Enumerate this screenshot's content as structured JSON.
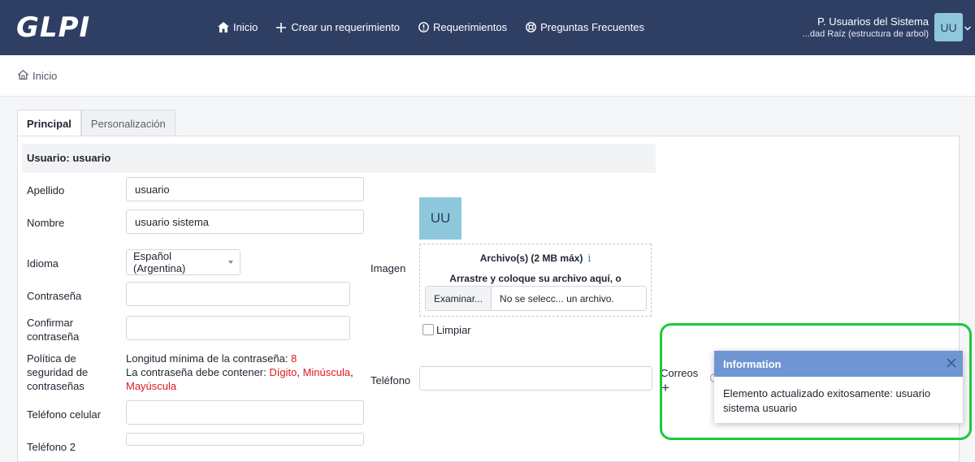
{
  "app": {
    "logo": "GLPI"
  },
  "nav": {
    "items": [
      {
        "icon": "home-icon",
        "label": "Inicio"
      },
      {
        "icon": "plus-icon",
        "label": "Crear un requerimiento"
      },
      {
        "icon": "alert-circle-icon",
        "label": "Requerimientos"
      },
      {
        "icon": "lifebuoy-icon",
        "label": "Preguntas Frecuentes"
      }
    ]
  },
  "user": {
    "profile": "P. Usuarios del Sistema",
    "entity": "...dad Raíz (estructura de arbol)",
    "initials": "UU"
  },
  "breadcrumb": {
    "home": "Inicio"
  },
  "tabs": [
    "Principal",
    "Personalización"
  ],
  "form": {
    "header": "Usuario: usuario",
    "apellido_label": "Apellido",
    "apellido_value": "usuario",
    "nombre_label": "Nombre",
    "nombre_value": "usuario sistema",
    "idioma_label": "Idioma",
    "idioma_value": "Español (Argentina)",
    "password_label": "Contraseña",
    "password_confirm_label": "Confirmar contraseña",
    "policy_label": "Política de seguridad de contraseñas",
    "policy_min_text": "Longitud mínima de la contraseña:",
    "policy_min_value": "8",
    "policy_contains_text": "La contraseña debe contener:",
    "policy_digit": "Dígito",
    "policy_lower": "Minúscula",
    "policy_upper": "Mayúscula",
    "mobile_label": "Teléfono celular",
    "phone2_label": "Teléfono 2",
    "image_label": "Imagen",
    "avatar_initials": "UU",
    "dropzone_title": "Archivo(s) (2 MB máx)",
    "dropzone_info": "i",
    "dropzone_sub": "Arrastre y coloque su archivo aquí, o",
    "browse_button": "Examinar...",
    "file_status": "No se selecc... un archivo.",
    "clear_label": "Limpiar",
    "phone_label": "Teléfono",
    "emails_label": "Correos"
  },
  "toast": {
    "title": "Information",
    "message": "Elemento actualizado exitosamente: usuario sistema usuario"
  },
  "colors": {
    "topbar": "#2f3f64",
    "avatar": "#8dc8dc",
    "toast_header": "#6f95d3",
    "highlight": "#1dc93a",
    "policy_red": "#e0191e"
  }
}
